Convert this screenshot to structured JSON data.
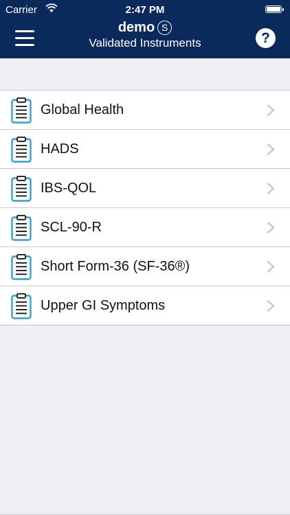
{
  "status_bar": {
    "carrier": "Carrier",
    "time": "2:47 PM"
  },
  "header": {
    "title": "demo",
    "title_badge": "S",
    "subtitle": "Validated Instruments",
    "help_label": "?"
  },
  "colors": {
    "nav_background": "#0b2a5c",
    "icon_accent": "#2aa3d6",
    "page_background": "#efeff4"
  },
  "icons": {
    "menu": "hamburger-menu-icon",
    "help": "question-circle-icon",
    "item": "clipboard-icon",
    "disclosure": "chevron-right-icon"
  },
  "instruments": [
    {
      "label": "Global Health"
    },
    {
      "label": "HADS"
    },
    {
      "label": "IBS-QOL"
    },
    {
      "label": "SCL-90-R"
    },
    {
      "label": "Short Form-36 (SF-36®)"
    },
    {
      "label": "Upper GI Symptoms"
    }
  ]
}
